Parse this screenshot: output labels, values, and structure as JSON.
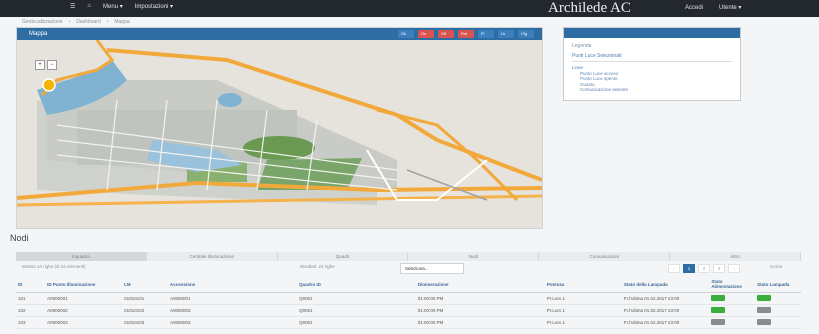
{
  "topbar": {
    "menu": [
      "☰",
      "⌂",
      "Menu ▾",
      "Impostazioni ▾"
    ],
    "brand": "Archilede AC",
    "right": [
      "Accedi",
      "Utente ▾"
    ]
  },
  "breadcrumb": [
    "Geolocalizzazione",
    "›",
    "Dashboard",
    "›",
    "Mappa"
  ],
  "map_panel": {
    "title": "Mappa",
    "buttons": [
      "Ok",
      "On",
      "Off",
      "Rst",
      "Fl",
      "Lk",
      "Cfg"
    ],
    "zoom": [
      "+",
      "−"
    ]
  },
  "legend": {
    "title": "Legenda",
    "subtitle": "Punti Luce Selezionati",
    "items": [
      "Linee",
      "Punto Luce acceso",
      "Punto Luce spento",
      "Guasto",
      "Comunicazione assente"
    ]
  },
  "section_title": "Nodi",
  "tabs": [
    "Inquadra",
    "Centrale Illuminazione",
    "Quadri",
    "Nodi",
    "Comunicazioni",
    "Altro"
  ],
  "table_controls": {
    "left": "Mostra 10 righe (di 24 elementi)",
    "middle": "Risultati: 24 righe",
    "select": "Seleziona...",
    "pages": [
      "‹",
      "1",
      "2",
      "3",
      "›"
    ],
    "search": "Cerca"
  },
  "table": {
    "headers": [
      "ID",
      "ID Punto Illuminazione",
      "LM",
      "Accensione",
      "Quadro ID",
      "Dimmerazione",
      "Potenza",
      "Stato della Lampada",
      "Stato Alimentazione",
      "Stato Lampada"
    ],
    "rows": [
      [
        "101",
        "A0000001",
        "01010101",
        "A0000001",
        "Q0001",
        "01:00:00 PM",
        "Pr.Lum 1",
        "Fr.l'ultima 01.02.2017 23:00",
        "g",
        "g"
      ],
      [
        "102",
        "A0000002",
        "01010102",
        "A0000002",
        "Q0001",
        "01:00:00 PM",
        "Pr.Lum 1",
        "Fr.l'ultima 01.02.2017 23:00",
        "g",
        "gr"
      ],
      [
        "103",
        "A0000003",
        "01010103",
        "A0000003",
        "Q0001",
        "01:00:00 PM",
        "Pr.Lum 1",
        "Fr.l'ultima 01.02.2017 23:00",
        "gr",
        "gr"
      ]
    ]
  }
}
